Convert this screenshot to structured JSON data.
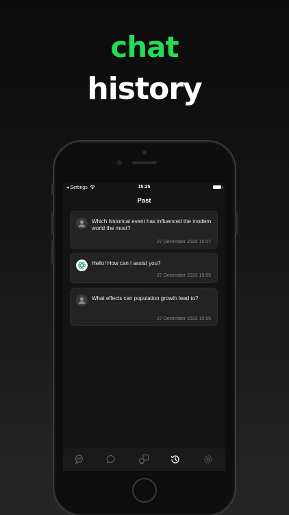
{
  "headline": {
    "line1": "chat",
    "line2": "history",
    "line1_color": "#22dd55"
  },
  "status_bar": {
    "back_label": "◂ Settings",
    "time": "15:25"
  },
  "nav": {
    "title": "Past"
  },
  "history": [
    {
      "avatar": "user-icon",
      "message": "Which historical event has influenced the modern world the most?",
      "date": "27 December 2023 15:07"
    },
    {
      "avatar": "openai-logo-icon",
      "message": "Hello! How can I assist you?",
      "date": "27 December 2023 15:59"
    },
    {
      "avatar": "user-icon",
      "message": "What effects can population growth lead to?",
      "date": "27 December 2023 15:55"
    }
  ],
  "tabs": [
    {
      "icon": "chat-bot-icon",
      "active": false
    },
    {
      "icon": "message-bubble-icon",
      "active": false
    },
    {
      "icon": "image-generate-icon",
      "active": false
    },
    {
      "icon": "history-clock-icon",
      "active": true
    },
    {
      "icon": "settings-gear-icon",
      "active": false
    }
  ],
  "colors": {
    "accent": "#22dd55",
    "card_bg": "#232323",
    "screen_bg": "#141414",
    "date_text": "#8a8a8a"
  }
}
